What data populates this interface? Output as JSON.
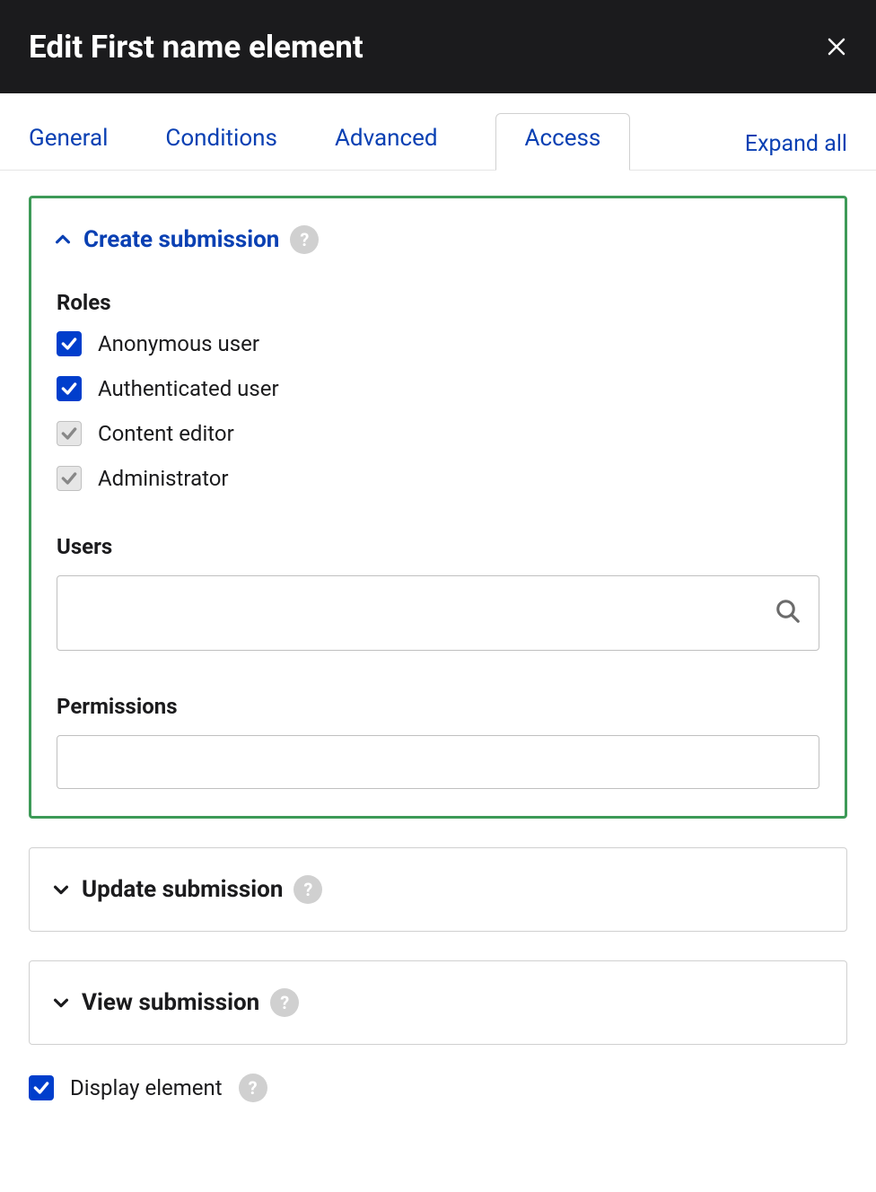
{
  "header": {
    "title": "Edit First name element"
  },
  "tabs": {
    "general": "General",
    "conditions": "Conditions",
    "advanced": "Advanced",
    "access": "Access"
  },
  "expand_all": "Expand all",
  "panels": {
    "create": {
      "title": "Create submission",
      "roles_label": "Roles",
      "roles": {
        "anonymous": "Anonymous user",
        "authenticated": "Authenticated user",
        "content_editor": "Content editor",
        "administrator": "Administrator"
      },
      "users_label": "Users",
      "users_value": "",
      "permissions_label": "Permissions",
      "permissions_value": ""
    },
    "update": {
      "title": "Update submission"
    },
    "view": {
      "title": "View submission"
    }
  },
  "display_element": {
    "label": "Display element"
  },
  "help_glyph": "?"
}
